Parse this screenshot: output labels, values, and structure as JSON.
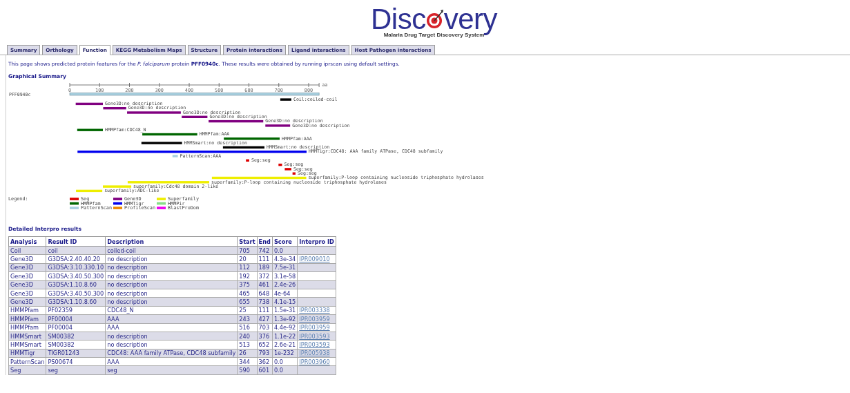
{
  "logo": {
    "before": "Disc",
    "after": "very",
    "subtitle": "Malaria Drug Target Discovery System"
  },
  "tabs": [
    {
      "label": "Summary",
      "selected": false
    },
    {
      "label": "Orthology",
      "selected": false
    },
    {
      "label": "Function",
      "selected": true
    },
    {
      "label": "KEGG Metabolism Maps",
      "selected": false
    },
    {
      "label": "Structure",
      "selected": false
    },
    {
      "label": "Protein interactions",
      "selected": false
    },
    {
      "label": "Ligand interactions",
      "selected": false
    },
    {
      "label": "Host Pathogen interactions",
      "selected": false
    }
  ],
  "intro": "This page shows predicted protein features for the *P. falciparum* protein **PFF0940c**. These results were obtained by running iprscan using default settings.",
  "graphical_summary": {
    "title": "Graphical Summary",
    "protein": "PFF0940c",
    "features": [
      {
        "label": "Coil:coiled-coil",
        "color": "#000000"
      },
      {
        "label": "Gene3D:no description",
        "color": "#800080"
      },
      {
        "label": "Gene3D:no description",
        "color": "#800080"
      },
      {
        "label": "Gene3D:no description",
        "color": "#800080"
      },
      {
        "label": "Gene3D:no description",
        "color": "#800080"
      },
      {
        "label": "Gene3D:no description",
        "color": "#800080"
      },
      {
        "label": "Gene3D:no description",
        "color": "#800080"
      },
      {
        "label": "HMMPfam:CDC48_N",
        "color": "#006600"
      },
      {
        "label": "HMMPfam:AAA",
        "color": "#006600"
      },
      {
        "label": "HMMPfam:AAA",
        "color": "#006600"
      },
      {
        "label": "HMMSmart:no description",
        "color": "#000000"
      },
      {
        "label": "HMMSmart:no description",
        "color": "#000000"
      },
      {
        "label": "HMMTigr:CDC48: AAA family ATPase, CDC48 subfamily",
        "color": "#0000ee"
      },
      {
        "label": "PatternScan:AAA",
        "color": "#a8d0e0"
      },
      {
        "label": "Seg:seg",
        "color": "#dd0000"
      },
      {
        "label": "Seg:seg",
        "color": "#dd0000"
      },
      {
        "label": "Seg:seg",
        "color": "#dd0000"
      },
      {
        "label": "Seg:seg",
        "color": "#dd0000"
      },
      {
        "label": "superfamily:P-loop containing nucleoside triphosphate hydrolases",
        "color": "#eeee00"
      },
      {
        "label": "superfamily:P-loop containing nucleoside triphosphate hydrolases",
        "color": "#eeee00"
      },
      {
        "label": "superfamily:Cdc48 domain 2-like",
        "color": "#eeee00"
      },
      {
        "label": "superfamily:ADC-like",
        "color": "#eeee00"
      }
    ],
    "ticks": [
      "0",
      "100",
      "200",
      "300",
      "400",
      "500",
      "600",
      "700",
      "800"
    ],
    "unit": "aa",
    "legend_title": "Legend:",
    "legend": [
      {
        "label": "Seg",
        "color": "#dd0000"
      },
      {
        "label": "HMMPfam",
        "color": "#006600"
      },
      {
        "label": "PatternScan",
        "color": "#a8d0e0"
      },
      {
        "label": "Gene3D",
        "color": "#800080"
      },
      {
        "label": "HMMTigr",
        "color": "#0000ee"
      },
      {
        "label": "ProfileScan",
        "color": "#ee8800"
      },
      {
        "label": "Superfamily",
        "color": "#eeee00"
      },
      {
        "label": "HMMPir",
        "color": "#88dd88"
      },
      {
        "label": "BlastProDom",
        "color": "#ee00ee"
      }
    ]
  },
  "results": {
    "title": "Detailed Interpro results",
    "columns": [
      "Analysis",
      "Result ID",
      "Description",
      "Start",
      "End",
      "Score",
      "Interpro ID"
    ],
    "rows": [
      [
        "Coil",
        "coil",
        "coiled-coil",
        "705",
        "742",
        "0.0",
        ""
      ],
      [
        "Gene3D",
        "G3DSA:2.40.40.20",
        "no description",
        "20",
        "111",
        "4.3e-34",
        "IPR009010"
      ],
      [
        "Gene3D",
        "G3DSA:3.10.330.10",
        "no description",
        "112",
        "189",
        "7.5e-31",
        ""
      ],
      [
        "Gene3D",
        "G3DSA:3.40.50.300",
        "no description",
        "192",
        "372",
        "3.1e-58",
        ""
      ],
      [
        "Gene3D",
        "G3DSA:1.10.8.60",
        "no description",
        "375",
        "461",
        "2.4e-26",
        ""
      ],
      [
        "Gene3D",
        "G3DSA:3.40.50.300",
        "no description",
        "465",
        "648",
        "4e-64",
        ""
      ],
      [
        "Gene3D",
        "G3DSA:1.10.8.60",
        "no description",
        "655",
        "738",
        "4.1e-15",
        ""
      ],
      [
        "HMMPfam",
        "PF02359",
        "CDC48_N",
        "25",
        "111",
        "1.5e-31",
        "IPR003338"
      ],
      [
        "HMMPfam",
        "PF00004",
        "AAA",
        "243",
        "427",
        "1.3e-92",
        "IPR003959"
      ],
      [
        "HMMPfam",
        "PF00004",
        "AAA",
        "516",
        "703",
        "4.4e-92",
        "IPR003959"
      ],
      [
        "HMMSmart",
        "SM00382",
        "no description",
        "240",
        "376",
        "1.1e-22",
        "IPR003593"
      ],
      [
        "HMMSmart",
        "SM00382",
        "no description",
        "513",
        "652",
        "2.6e-21",
        "IPR003593"
      ],
      [
        "HMMTigr",
        "TIGR01243",
        "CDC48: AAA family ATPase, CDC48 subfamily",
        "26",
        "793",
        "1e-232",
        "IPR005938"
      ],
      [
        "PatternScan",
        "PS00674",
        "AAA",
        "344",
        "362",
        "0.0",
        "IPR003960"
      ],
      [
        "Seg",
        "seg",
        "seg",
        "590",
        "601",
        "0.0",
        ""
      ]
    ]
  }
}
